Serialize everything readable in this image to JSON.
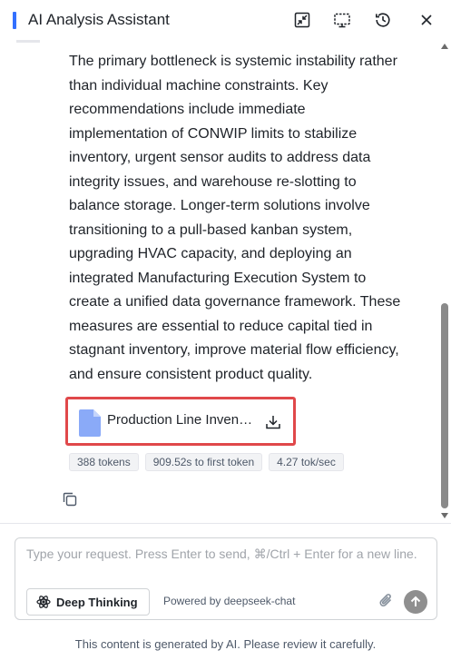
{
  "header": {
    "title": "AI Analysis Assistant",
    "icons": [
      "exit-fullscreen-icon",
      "screen-share-icon",
      "history-icon",
      "close-icon"
    ]
  },
  "message": {
    "answer_text": "The primary bottleneck is systemic instability rather than individual machine constraints. Key recommendations include immediate implementation of CONWIP limits to stabilize inventory, urgent sensor audits to address data integrity issues, and warehouse re-slotting to balance storage. Longer-term solutions involve transitioning to a pull-based kanban system, upgrading HVAC capacity, and deploying an integrated Manufacturing Execution System to create a unified data governance framework. These measures are essential to reduce capital tied in stagnant inventory, improve material flow efficiency, and ensure consistent product quality.",
    "attachment": {
      "name": "Production Line Inven…",
      "icon": "document-icon",
      "action_icon": "download-icon"
    },
    "stats": {
      "tokens": "388 tokens",
      "first_token": "909.52s to first token",
      "speed": "4.27 tok/sec"
    },
    "copy_icon": "copy-icon"
  },
  "input": {
    "placeholder": "Type your request. Press Enter to send, ⌘/Ctrl + Enter for a new line.",
    "value": "",
    "deep_thinking_label": "Deep Thinking",
    "powered_by": "Powered by deepseek-chat"
  },
  "footer": {
    "disclaimer": "This content is generated by AI. Please review it carefully."
  },
  "colors": {
    "accent": "#3370ff",
    "highlight_border": "#e0484a",
    "send_button": "#8f8f8f",
    "file_icon": "#8aaaf8"
  }
}
